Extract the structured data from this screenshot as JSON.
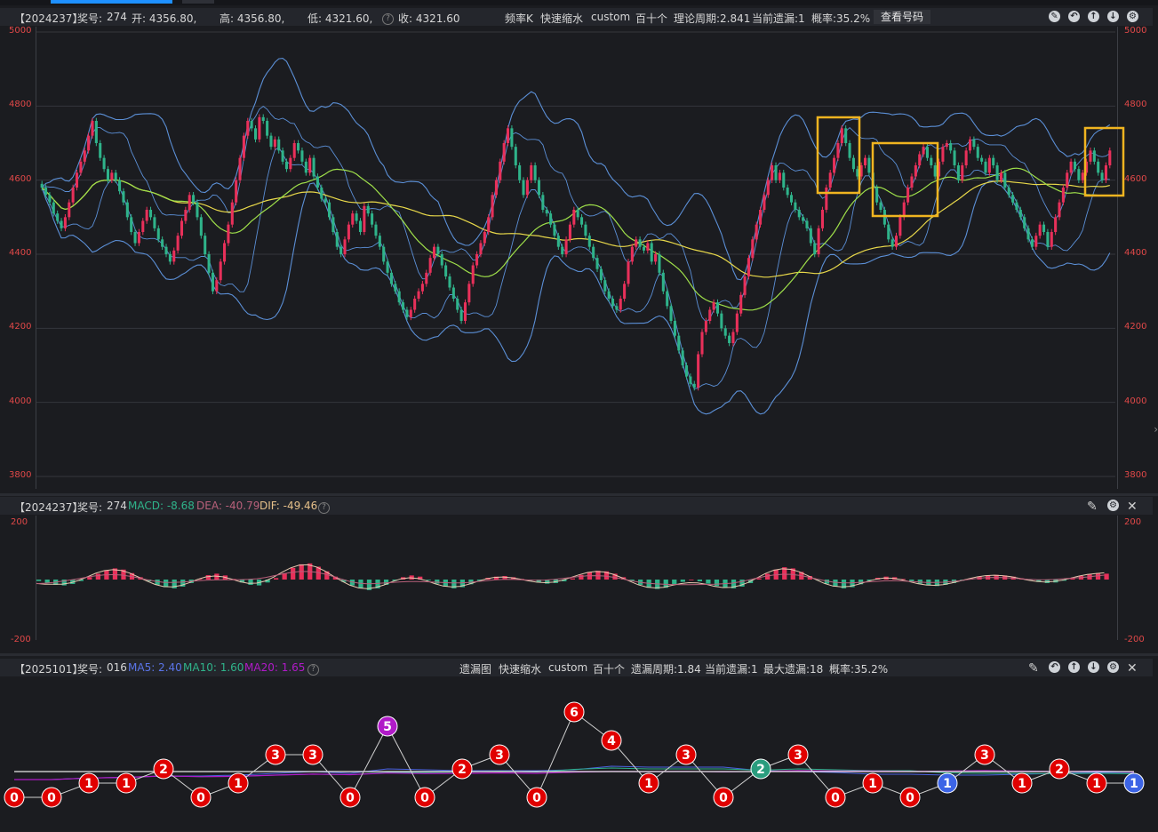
{
  "tabs": {
    "active_color": "#1e90ff"
  },
  "main_panel": {
    "info": {
      "period": "【2024237】",
      "award_label": "奖号:",
      "award": "274",
      "open": "开: 4356.80,",
      "high": "高: 4356.80,",
      "low": "低: 4321.60,",
      "close": "收: 4321.60"
    },
    "center": {
      "title": "频率K",
      "mode": "快速缩水",
      "custom": "custom",
      "digit": "百十个",
      "theory_period": "理论周期:2.841",
      "current_miss": "当前遗漏:1",
      "probability": "概率:35.2%",
      "view_code_button": "查看号码"
    },
    "icons": [
      "edit-icon",
      "undo-icon",
      "arrow-up-icon",
      "arrow-down-icon",
      "settings-icon"
    ]
  },
  "macd_panel": {
    "info": {
      "period": "【2024237】",
      "award_label": "奖号:",
      "award": "274",
      "macd": "MACD: -8.68",
      "dea": "DEA: -40.79",
      "dif": "DIF: -49.46"
    },
    "icons": [
      "pin-icon",
      "settings-icon",
      "close-icon"
    ]
  },
  "miss_panel": {
    "info": {
      "period": "【2025101】",
      "award_label": "奖号:",
      "award": "016",
      "ma5": "MA5: 2.40",
      "ma10": "MA10: 1.60",
      "ma20": "MA20: 1.65"
    },
    "center": {
      "title": "遗漏图",
      "mode": "快速缩水",
      "custom": "custom",
      "digit": "百十个",
      "miss_period": "遗漏周期:1.84",
      "current_miss": "当前遗漏:1",
      "max_miss": "最大遗漏:18",
      "probability": "概率:35.2%"
    },
    "icons": [
      "pin-icon",
      "undo-icon",
      "arrow-up-icon",
      "arrow-down-icon",
      "settings-icon",
      "close-icon"
    ]
  },
  "colors": {
    "up": "#e8305a",
    "down": "#2fb38a",
    "boll": "#5b8fd6",
    "ma_yellow": "#e8d84a",
    "ma_green": "#9fe04a",
    "marker_box": "#f0b420",
    "red_bubble": "#e00000",
    "purple_bubble": "#b01ac8",
    "teal_bubble": "#2a9d7e",
    "blue_bubble": "#3c64e6"
  },
  "chart_data": [
    {
      "type": "candlestick",
      "ylim": [
        3800,
        5000
      ],
      "yticks": [
        "5000",
        "4800",
        "4600",
        "4400",
        "4200",
        "4000",
        "3800"
      ],
      "close": [
        4580,
        4560,
        4540,
        4510,
        4490,
        4470,
        4500,
        4540,
        4580,
        4620,
        4650,
        4680,
        4720,
        4760,
        4700,
        4660,
        4630,
        4600,
        4620,
        4600,
        4570,
        4540,
        4500,
        4460,
        4430,
        4460,
        4490,
        4520,
        4500,
        4470,
        4440,
        4420,
        4400,
        4380,
        4410,
        4450,
        4490,
        4520,
        4560,
        4540,
        4500,
        4450,
        4400,
        4350,
        4300,
        4330,
        4380,
        4430,
        4480,
        4540,
        4600,
        4660,
        4720,
        4760,
        4740,
        4710,
        4770,
        4760,
        4720,
        4690,
        4710,
        4680,
        4650,
        4630,
        4660,
        4700,
        4680,
        4650,
        4620,
        4660,
        4610,
        4580,
        4550,
        4540,
        4500,
        4460,
        4420,
        4400,
        4440,
        4480,
        4510,
        4490,
        4460,
        4530,
        4510,
        4480,
        4450,
        4420,
        4380,
        4350,
        4320,
        4300,
        4270,
        4250,
        4230,
        4250,
        4280,
        4300,
        4320,
        4350,
        4390,
        4420,
        4400,
        4370,
        4340,
        4310,
        4280,
        4250,
        4220,
        4270,
        4320,
        4370,
        4400,
        4430,
        4460,
        4500,
        4560,
        4600,
        4650,
        4700,
        4740,
        4690,
        4640,
        4600,
        4560,
        4600,
        4640,
        4600,
        4560,
        4520,
        4510,
        4480,
        4450,
        4420,
        4400,
        4440,
        4480,
        4520,
        4500,
        4480,
        4450,
        4420,
        4390,
        4360,
        4330,
        4300,
        4280,
        4260,
        4250,
        4280,
        4320,
        4380,
        4420,
        4440,
        4420,
        4410,
        4430,
        4380,
        4400,
        4350,
        4300,
        4260,
        4220,
        4180,
        4140,
        4100,
        4070,
        4050,
        4040,
        4130,
        4190,
        4220,
        4250,
        4270,
        4240,
        4200,
        4180,
        4160,
        4190,
        4240,
        4290,
        4340,
        4390,
        4440,
        4480,
        4520,
        4560,
        4600,
        4640,
        4600,
        4620,
        4580,
        4560,
        4540,
        4520,
        4500,
        4490,
        4470,
        4430,
        4400,
        4470,
        4520,
        4580,
        4620,
        4660,
        4700,
        4740,
        4700,
        4660,
        4630,
        4610,
        4640,
        4660,
        4620,
        4580,
        4540,
        4520,
        4480,
        4440,
        4420,
        4450,
        4500,
        4540,
        4580,
        4610,
        4640,
        4670,
        4690,
        4660,
        4640,
        4610,
        4650,
        4690,
        4700,
        4680,
        4640,
        4600,
        4640,
        4680,
        4710,
        4690,
        4660,
        4650,
        4620,
        4660,
        4640,
        4600,
        4620,
        4580,
        4560,
        4540,
        4520,
        4500,
        4470,
        4440,
        4420,
        4450,
        4480,
        4460,
        4420,
        4460,
        4500,
        4540,
        4580,
        4620,
        4650,
        4630,
        4600,
        4620,
        4650,
        4680,
        4650,
        4620,
        4600,
        4640,
        4680
      ]
    },
    {
      "type": "bar",
      "ylim": [
        -200,
        200
      ],
      "yticks": [
        "200",
        "-200"
      ],
      "macd_series": [
        -5,
        -12,
        -18,
        -20,
        -15,
        -5,
        8,
        20,
        32,
        38,
        34,
        22,
        8,
        -6,
        -18,
        -26,
        -30,
        -24,
        -12,
        2,
        15,
        20,
        14,
        2,
        -10,
        -18,
        -20,
        -10,
        5,
        22,
        40,
        52,
        55,
        44,
        28,
        10,
        -8,
        -20,
        -30,
        -36,
        -30,
        -18,
        -4,
        8,
        14,
        10,
        -2,
        -14,
        -24,
        -30,
        -26,
        -16,
        -4,
        6,
        10,
        12,
        8,
        2,
        -4,
        -10,
        -14,
        -12,
        -6,
        4,
        16,
        26,
        30,
        28,
        20,
        8,
        -6,
        -18,
        -28,
        -32,
        -28,
        -18,
        -8,
        0,
        -6,
        -14,
        -22,
        -28,
        -30,
        -24,
        -12,
        4,
        20,
        34,
        42,
        38,
        26,
        12,
        -2,
        -14,
        -24,
        -30,
        -26,
        -16,
        -4,
        6,
        10,
        8,
        2,
        -6,
        -14,
        -20,
        -22,
        -18,
        -12,
        -4,
        4,
        10,
        14,
        16,
        14,
        10,
        4,
        -2,
        -8,
        -12,
        -10,
        -4,
        4,
        12,
        18,
        22,
        20
      ]
    },
    {
      "type": "scatter",
      "ylim": [
        0,
        6
      ],
      "bubbles": [
        {
          "v": 0,
          "label": "0",
          "kind": "red"
        },
        {
          "v": 0,
          "label": "0",
          "kind": "red"
        },
        {
          "v": 1,
          "label": "1",
          "kind": "red"
        },
        {
          "v": 1,
          "label": "1",
          "kind": "red"
        },
        {
          "v": 2,
          "label": "2",
          "kind": "red"
        },
        {
          "v": 0,
          "label": "0",
          "kind": "red"
        },
        {
          "v": 1,
          "label": "1",
          "kind": "red"
        },
        {
          "v": 3,
          "label": "3",
          "kind": "red"
        },
        {
          "v": 3,
          "label": "3",
          "kind": "red"
        },
        {
          "v": 0,
          "label": "0",
          "kind": "red"
        },
        {
          "v": 5,
          "label": "5",
          "kind": "purple"
        },
        {
          "v": 0,
          "label": "0",
          "kind": "red"
        },
        {
          "v": 2,
          "label": "2",
          "kind": "red"
        },
        {
          "v": 3,
          "label": "3",
          "kind": "red"
        },
        {
          "v": 0,
          "label": "0",
          "kind": "red"
        },
        {
          "v": 6,
          "label": "6",
          "kind": "red"
        },
        {
          "v": 4,
          "label": "4",
          "kind": "red"
        },
        {
          "v": 1,
          "label": "1",
          "kind": "red"
        },
        {
          "v": 3,
          "label": "3",
          "kind": "red"
        },
        {
          "v": 0,
          "label": "0",
          "kind": "red"
        },
        {
          "v": 2,
          "label": "2",
          "kind": "teal"
        },
        {
          "v": 3,
          "label": "3",
          "kind": "red"
        },
        {
          "v": 0,
          "label": "0",
          "kind": "red"
        },
        {
          "v": 1,
          "label": "1",
          "kind": "red"
        },
        {
          "v": 0,
          "label": "0",
          "kind": "red"
        },
        {
          "v": 1,
          "label": "1",
          "kind": "blue"
        },
        {
          "v": 3,
          "label": "3",
          "kind": "red"
        },
        {
          "v": 1,
          "label": "1",
          "kind": "red"
        },
        {
          "v": 2,
          "label": "2",
          "kind": "red"
        },
        {
          "v": 1,
          "label": "1",
          "kind": "red"
        },
        {
          "v": 1,
          "label": "1",
          "kind": "blue"
        }
      ]
    }
  ]
}
